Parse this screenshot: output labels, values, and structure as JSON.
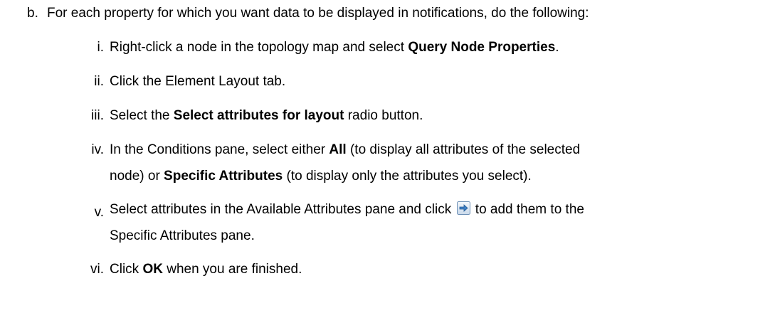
{
  "step_b": {
    "marker": "b.",
    "text": "For each property for which you want data to be displayed in notifications, do the following:"
  },
  "steps": [
    {
      "marker": "i.",
      "before": "Right-click a node in the topology map and select ",
      "bold": "Query Node Properties",
      "after": "."
    },
    {
      "marker": "ii.",
      "text": "Click the Element Layout tab."
    },
    {
      "marker": "iii.",
      "before": "Select the ",
      "bold": "Select attributes for layout",
      "after": " radio button."
    },
    {
      "marker": "iv.",
      "line1_before": "In the Conditions pane, select either ",
      "line1_bold": "All",
      "line1_after": " (to display all attributes of the selected",
      "line2_before": "node) or ",
      "line2_bold": "Specific Attributes",
      "line2_after": " (to display only the attributes you select)."
    },
    {
      "marker": "v.",
      "line1_before": "Select attributes in the Available Attributes pane and click ",
      "line1_after": " to add them to the",
      "line2": "Specific Attributes pane.",
      "icon": "add-right-arrow-icon"
    },
    {
      "marker": "vi.",
      "before": "Click ",
      "bold": "OK",
      "after": " when you are finished."
    }
  ]
}
